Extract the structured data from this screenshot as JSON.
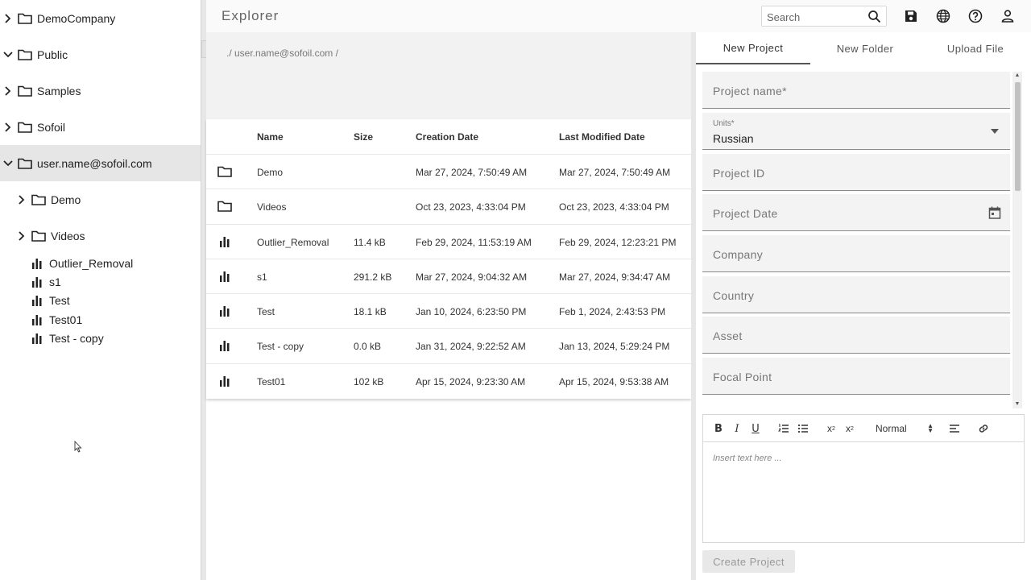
{
  "sidebar": {
    "items": [
      {
        "label": "DemoCompany",
        "chevron": "chevron-right-icon"
      },
      {
        "label": "Public",
        "chevron": "chevron-down-icon"
      },
      {
        "label": "Samples",
        "chevron": "chevron-right-icon"
      },
      {
        "label": "Sofoil",
        "chevron": "chevron-right-icon"
      },
      {
        "label": "user.name@sofoil.com",
        "chevron": "chevron-down-icon",
        "selected": true
      }
    ],
    "children": [
      {
        "label": "Demo"
      },
      {
        "label": "Videos"
      }
    ],
    "leaves": [
      {
        "label": "Outlier_Removal"
      },
      {
        "label": "s1"
      },
      {
        "label": "Test"
      },
      {
        "label": "Test01"
      },
      {
        "label": "Test - copy"
      }
    ]
  },
  "header": {
    "title": "Explorer",
    "search_placeholder": "Search",
    "icons": [
      "save-icon",
      "globe-icon",
      "help-icon",
      "account-icon"
    ]
  },
  "files": {
    "breadcrumb": "./ user.name@sofoil.com /",
    "columns": [
      "Name",
      "Size",
      "Creation Date",
      "Last Modified Date"
    ],
    "rows": [
      {
        "type": "folder",
        "name": "Demo",
        "size": "",
        "created": "Mar 27, 2024, 7:50:49 AM",
        "modified": "Mar 27, 2024, 7:50:49 AM"
      },
      {
        "type": "folder",
        "name": "Videos",
        "size": "",
        "created": "Oct 23, 2023, 4:33:04 PM",
        "modified": "Oct 23, 2023, 4:33:04 PM"
      },
      {
        "type": "chart",
        "name": "Outlier_Removal",
        "size": "11.4 kB",
        "created": "Feb 29, 2024, 11:53:19 AM",
        "modified": "Feb 29, 2024, 12:23:21 PM"
      },
      {
        "type": "chart",
        "name": "s1",
        "size": "291.2 kB",
        "created": "Mar 27, 2024, 9:04:32 AM",
        "modified": "Mar 27, 2024, 9:34:47 AM"
      },
      {
        "type": "chart",
        "name": "Test",
        "size": "18.1 kB",
        "created": "Jan 10, 2024, 6:23:50 PM",
        "modified": "Feb 1, 2024, 2:43:53 PM"
      },
      {
        "type": "chart",
        "name": "Test - copy",
        "size": "0.0 kB",
        "created": "Jan 31, 2024, 9:22:52 AM",
        "modified": "Jan 13, 2024, 5:29:24 PM"
      },
      {
        "type": "chart",
        "name": "Test01",
        "size": "102 kB",
        "created": "Apr 15, 2024, 9:23:30 AM",
        "modified": "Apr 15, 2024, 9:53:38 AM"
      }
    ]
  },
  "panel": {
    "tabs": [
      "New Project",
      "New Folder",
      "Upload File"
    ],
    "active_tab": "New Project",
    "fields": {
      "project_name": "Project name*",
      "units_label": "Units*",
      "units_value": "Russian",
      "project_id": "Project ID",
      "project_date": "Project Date",
      "company": "Company",
      "country": "Country",
      "asset": "Asset",
      "focal_point": "Focal Point"
    },
    "editor": {
      "format_select": "Normal",
      "placeholder": "Insert text here ..."
    },
    "create_button": "Create Project"
  }
}
